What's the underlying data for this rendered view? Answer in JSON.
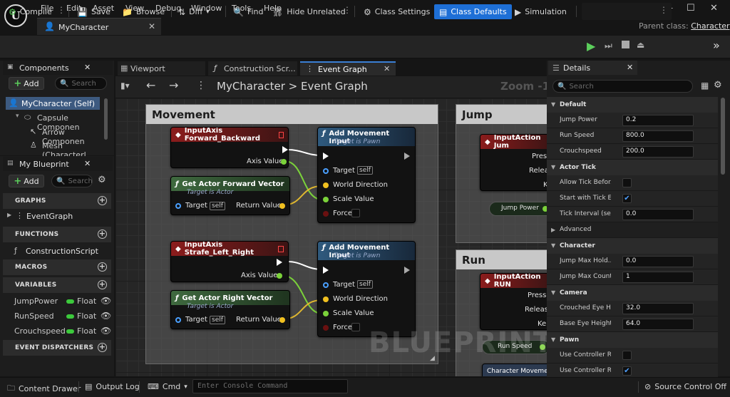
{
  "menu": [
    "File",
    "Edit",
    "Asset",
    "View",
    "Debug",
    "Window",
    "Tools",
    "Help"
  ],
  "window_controls": {
    "minimize": "—",
    "maximize": "☐",
    "close": "✕"
  },
  "doc_tab": {
    "label": "MyCharacter",
    "close": "✕"
  },
  "parent_class": {
    "label": "Parent class:",
    "value": "Character"
  },
  "toolbar": {
    "compile": "Compile",
    "save": "Save",
    "browse": "Browse",
    "diff": "Diff",
    "find": "Find",
    "hide_unrelated": "Hide Unrelated",
    "class_settings": "Class Settings",
    "class_defaults": "Class Defaults",
    "simulation": "Simulation"
  },
  "components": {
    "title": "Components",
    "add": "Add",
    "search_placeholder": "Search",
    "items": [
      "MyCharacter (Self)",
      "Capsule Componen",
      "Arrow Componen",
      "Mesh (Characterl"
    ]
  },
  "my_blueprint": {
    "title": "My Blueprint",
    "add": "Add",
    "search_placeholder": "Search",
    "sections": {
      "graphs": "GRAPHS",
      "functions": "FUNCTIONS",
      "macros": "MACROS",
      "variables": "VARIABLES",
      "event_dispatchers": "EVENT DISPATCHERS"
    },
    "graphs": [
      "EventGraph"
    ],
    "functions": [
      "ConstructionScript"
    ],
    "variables": [
      {
        "name": "JumpPower",
        "type": "Float"
      },
      {
        "name": "RunSpeed",
        "type": "Float"
      },
      {
        "name": "Crouchspeed",
        "type": "Float"
      }
    ]
  },
  "editor_tabs": [
    "Viewport",
    "Construction Scr...",
    "Event Graph"
  ],
  "breadcrumb": {
    "root": "MyCharacter",
    "sep": ">",
    "leaf": "Event Graph"
  },
  "zoom": "Zoom -1",
  "graph": {
    "watermark": "BLUEPRINT",
    "comments": {
      "movement": "Movement",
      "jump": "Jump",
      "run": "Run"
    },
    "nodes": {
      "input_fwd": {
        "title": "InputAxis Forward_Backward",
        "pin": "Axis Value"
      },
      "get_fwd": {
        "title": "Get Actor Forward Vector",
        "sub": "Target is Actor",
        "target": "Target",
        "self": "self",
        "ret": "Return Value"
      },
      "add_mov1": {
        "title": "Add Movement Input",
        "sub": "Target is Pawn",
        "target": "Target",
        "self": "self",
        "dir": "World Direction",
        "scale": "Scale Value",
        "force": "Force"
      },
      "input_strafe": {
        "title": "InputAxis Strafe_Left_Right",
        "pin": "Axis Value"
      },
      "get_right": {
        "title": "Get Actor Right Vector",
        "sub": "Target is Actor",
        "target": "Target",
        "self": "self",
        "ret": "Return Value"
      },
      "add_mov2": {
        "title": "Add Movement Input",
        "sub": "Target is Pawn",
        "target": "Target",
        "self": "self",
        "dir": "World Direction",
        "scale": "Scale Value",
        "force": "Force"
      },
      "jump_input": {
        "title": "InputAction Jum",
        "pressed": "Press",
        "released": "Releas",
        "key": "K"
      },
      "jump_power": {
        "label": "Jump Power"
      },
      "run_input": {
        "title": "InputAction RUN",
        "pressed": "Presse",
        "released": "Release",
        "key": "Ke"
      },
      "run_speed": {
        "label": "Run Speed"
      },
      "char_move": {
        "label": "Character Moveme"
      }
    }
  },
  "details": {
    "title": "Details",
    "search_placeholder": "Search",
    "sections": [
      {
        "name": "Default",
        "rows": [
          {
            "label": "Jump Power",
            "value": "0.2"
          },
          {
            "label": "Run Speed",
            "value": "800.0"
          },
          {
            "label": "Crouchspeed",
            "value": "200.0"
          }
        ]
      },
      {
        "name": "Actor Tick",
        "rows": [
          {
            "label": "Allow Tick Befor...",
            "check": false
          },
          {
            "label": "Start with Tick E...",
            "check": true
          },
          {
            "label": "Tick Interval (se...",
            "value": "0.0"
          }
        ],
        "advanced": "Advanced"
      },
      {
        "name": "Character",
        "rows": [
          {
            "label": "Jump Max Hold...",
            "value": "0.0"
          },
          {
            "label": "Jump Max Count",
            "value": "1"
          }
        ]
      },
      {
        "name": "Camera",
        "rows": [
          {
            "label": "Crouched Eye He...",
            "value": "32.0"
          },
          {
            "label": "Base Eye Height",
            "value": "64.0"
          }
        ]
      },
      {
        "name": "Pawn",
        "rows": [
          {
            "label": "Use Controller R...",
            "check": false
          },
          {
            "label": "Use Controller R...",
            "check": true
          }
        ]
      }
    ]
  },
  "bottom": {
    "content_drawer": "Content Drawer",
    "output_log": "Output Log",
    "cmd": "Cmd",
    "console_placeholder": "Enter Console Command",
    "source_control": "Source Control Off"
  },
  "colors": {
    "accent": "#1e6fd6",
    "exec_green": "#3cc93c",
    "vector_yellow": "#f0c020",
    "float_green": "#8be04a",
    "input_red": "#8b1c1c"
  }
}
